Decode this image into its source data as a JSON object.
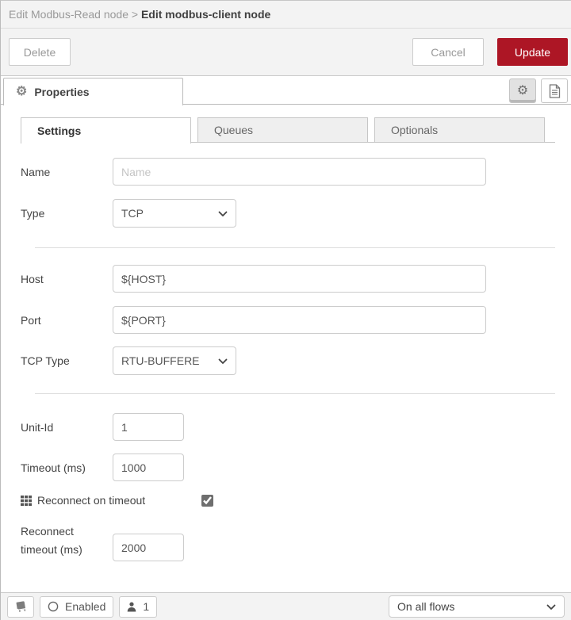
{
  "breadcrumb": {
    "previous": "Edit Modbus-Read node",
    "separator": ">",
    "current": "Edit modbus-client node"
  },
  "toolbar": {
    "delete_label": "Delete",
    "cancel_label": "Cancel",
    "update_label": "Update"
  },
  "properties_panel": {
    "title": "Properties"
  },
  "tabs": {
    "settings": "Settings",
    "queues": "Queues",
    "optionals": "Optionals"
  },
  "form": {
    "name": {
      "label": "Name",
      "placeholder": "Name",
      "value": ""
    },
    "type": {
      "label": "Type",
      "value": "TCP"
    },
    "host": {
      "label": "Host",
      "value": "${HOST}"
    },
    "port": {
      "label": "Port",
      "value": "${PORT}"
    },
    "tcp_type": {
      "label": "TCP Type",
      "value": "RTU-BUFFERED"
    },
    "unit_id": {
      "label": "Unit-Id",
      "value": "1"
    },
    "timeout": {
      "label": "Timeout (ms)",
      "value": "1000"
    },
    "reconnect_on_timeout": {
      "label": "Reconnect on timeout",
      "checked": true
    },
    "reconnect_timeout": {
      "label_line1": "Reconnect",
      "label_line2": "timeout (ms)",
      "value": "2000"
    }
  },
  "footer": {
    "enabled_label": "Enabled",
    "user_count": "1",
    "scope_value": "On all flows"
  },
  "colors": {
    "accent_red": "#ad1625",
    "header_bg": "#f3f3f3",
    "border": "#cccccc"
  }
}
